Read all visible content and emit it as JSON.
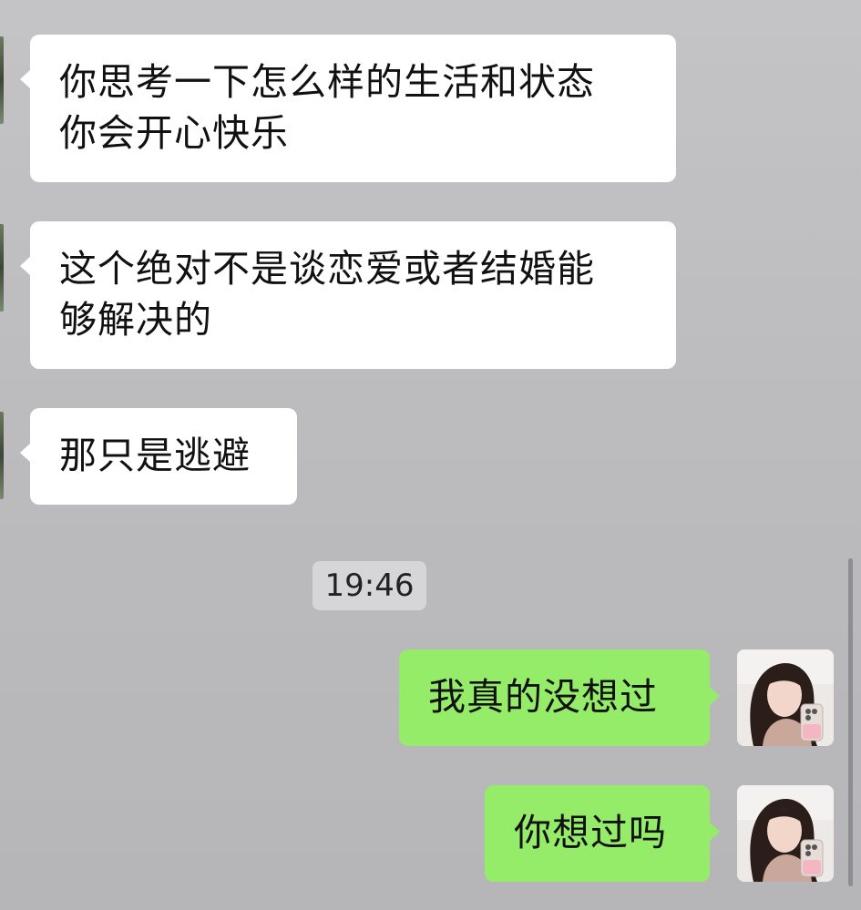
{
  "conversation": {
    "incoming": [
      {
        "text": "你思考一下怎么样的生活和状态\n你会开心快乐"
      },
      {
        "text": "这个绝对不是谈恋爱或者结婚能\n够解决的"
      },
      {
        "text": "那只是逃避"
      }
    ],
    "timestamp": "19:46",
    "outgoing": [
      {
        "text": "我真的没想过"
      },
      {
        "text": "你想过吗"
      }
    ]
  },
  "colors": {
    "background": "#bcbcbe",
    "incoming_bubble": "#ffffff",
    "outgoing_bubble": "#95ec69",
    "timestamp_bg": "#d6d6d8"
  }
}
